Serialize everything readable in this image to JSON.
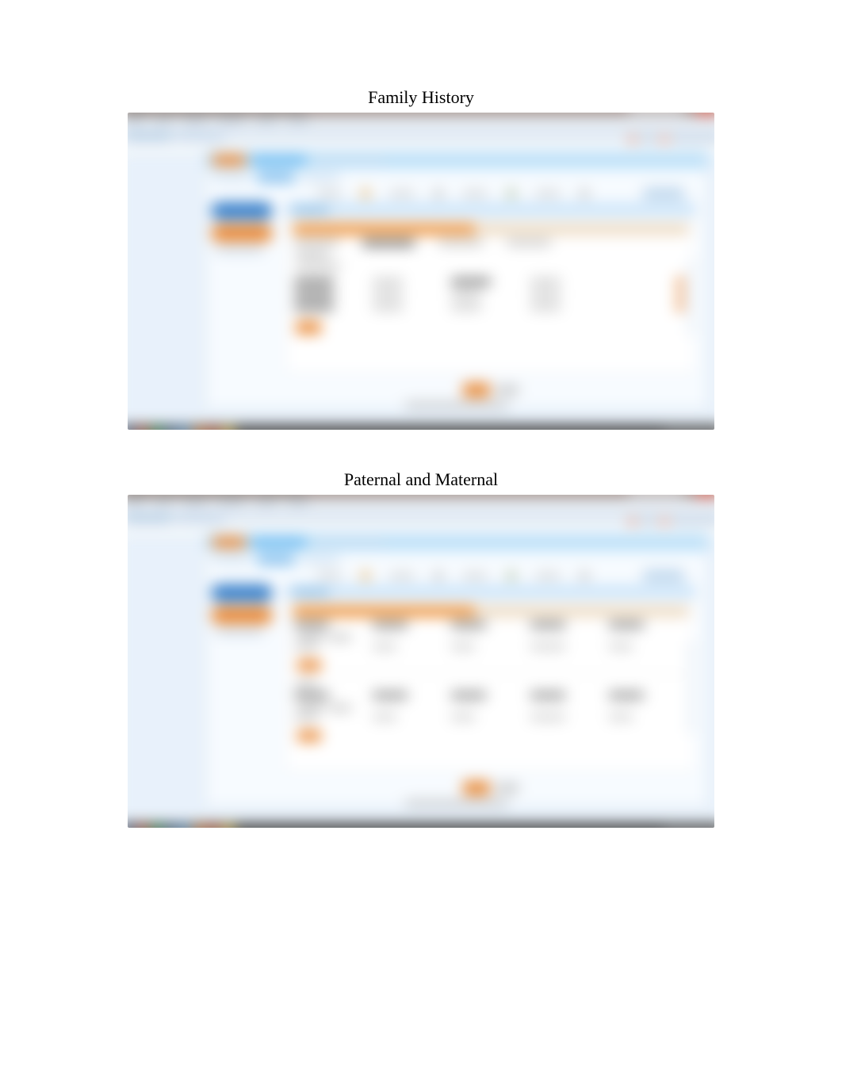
{
  "captions": {
    "first": "Family History",
    "second": "Paternal and Maternal"
  },
  "colors": {
    "accent_orange": "#e58a3c",
    "accent_blue": "#3a7fc5",
    "page_bg": "#e8f1fa"
  },
  "note": "Embedded screenshots are heavily blurred in the source image; no legible application text, labels, values, menu items, or field contents can be read. Only the two plain-text captions above are visible."
}
